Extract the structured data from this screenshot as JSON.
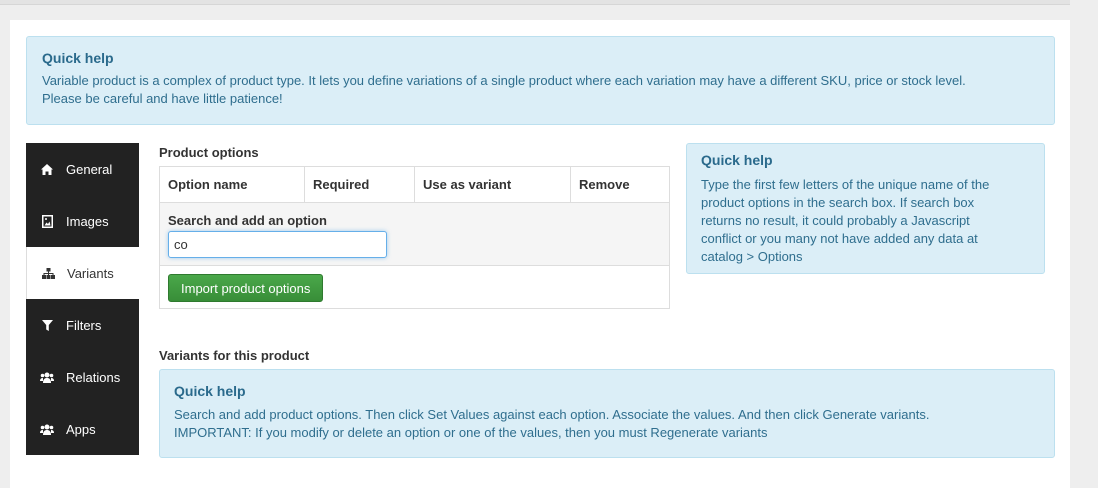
{
  "quick_help_top": {
    "title": "Quick help",
    "line1": "Variable product is a complex of product type. It lets you define variations of a single product where each variation may have a different SKU, price or stock level.",
    "line2": "Please be careful and have little patience!"
  },
  "sidebar": {
    "items": [
      {
        "label": "General",
        "icon": "home-icon"
      },
      {
        "label": "Images",
        "icon": "image-icon"
      },
      {
        "label": "Variants",
        "icon": "sitemap-icon",
        "active": true
      },
      {
        "label": "Filters",
        "icon": "filter-icon"
      },
      {
        "label": "Relations",
        "icon": "users-icon"
      },
      {
        "label": "Apps",
        "icon": "users-icon"
      }
    ]
  },
  "product_options": {
    "title": "Product options",
    "columns": [
      "Option name",
      "Required",
      "Use as variant",
      "Remove"
    ],
    "search_label": "Search and add an option",
    "search_value": "co",
    "import_button": "Import product options"
  },
  "quick_help_right": {
    "title": "Quick help",
    "lines": [
      "Type the first few letters of the unique name of the",
      "product options in the search box. If search box",
      "returns no result, it could probably a Javascript",
      "conflict or you many not have added any data at",
      "catalog > Options"
    ]
  },
  "variants": {
    "title": "Variants for this product"
  },
  "quick_help_bottom": {
    "title": "Quick help",
    "line1": "Search and add product options. Then click Set Values against each option. Associate the values. And then click Generate variants.",
    "line2": "IMPORTANT: If you modify or delete an option or one of the values, then you must Regenerate variants"
  },
  "colors": {
    "sidebar_bg": "#222222",
    "help_bg": "#dbeef7",
    "help_text": "#2f6e8e",
    "button_green": "#3f9b3f"
  }
}
